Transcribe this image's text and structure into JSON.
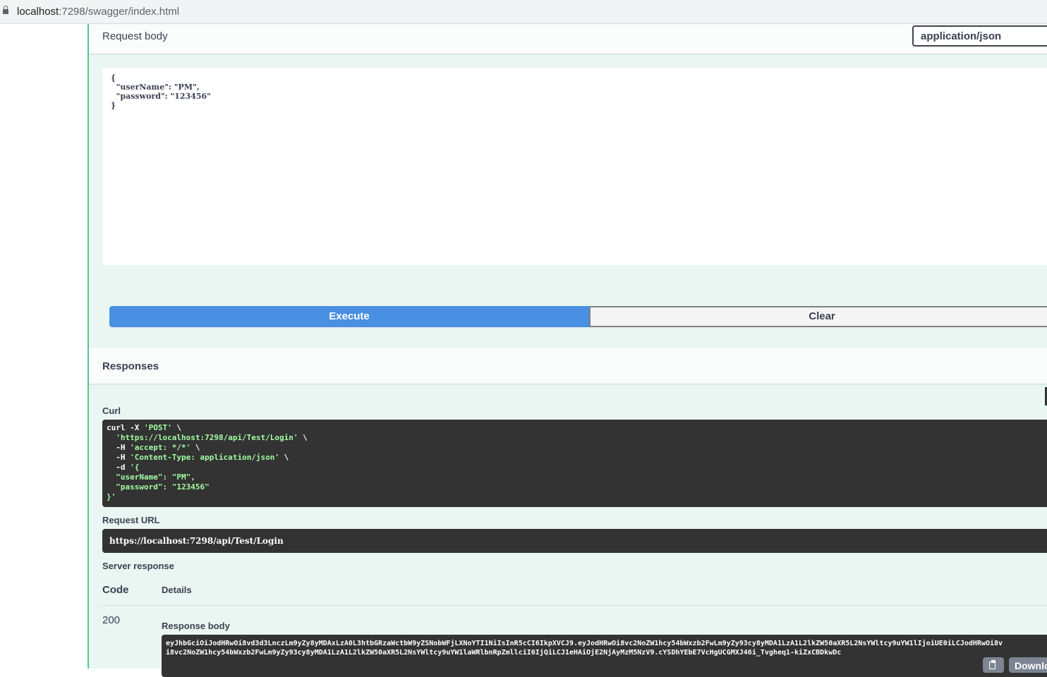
{
  "browser": {
    "url_host": "localhost",
    "url_rest": ":7298/swagger/index.html"
  },
  "request": {
    "title": "Request body",
    "content_type": "application/json",
    "body": "{\n  \"userName\": \"PM\",\n  \"password\": \"123456\"\n}",
    "execute_label": "Execute",
    "clear_label": "Clear"
  },
  "responses": {
    "title": "Responses",
    "curl_label": "Curl",
    "curl_lines": [
      {
        "pre": "curl -X ",
        "str": "'POST'",
        "post": " \\"
      },
      {
        "pre": "  ",
        "str": "'https://localhost:7298/api/Test/Login'",
        "post": " \\"
      },
      {
        "pre": "  -H ",
        "str": "'accept: */*'",
        "post": " \\"
      },
      {
        "pre": "  -H ",
        "str": "'Content-Type: application/json'",
        "post": " \\"
      },
      {
        "pre": "  -d ",
        "str": "'{",
        "post": ""
      },
      {
        "pre": "",
        "str": "  \"userName\": \"PM\",",
        "post": ""
      },
      {
        "pre": "",
        "str": "  \"password\": \"123456\"",
        "post": ""
      },
      {
        "pre": "",
        "str": "}'",
        "post": ""
      }
    ],
    "request_url_label": "Request URL",
    "request_url": "https://localhost:7298/api/Test/Login",
    "server_response_label": "Server response",
    "code_header": "Code",
    "details_header": "Details",
    "code": "200",
    "response_body_label": "Response body",
    "response_body": "eyJhbGciOiJodHRwOi8vd3d3LnczLm9yZy8yMDAxLzA0L3htbGRzaWctbW9yZSNobWFjLXNoYTI1NiIsInR5cCI6IkpXVCJ9.eyJodHRwOi8vc2NoZW1hcy54bWxzb2FwLm9yZy93cy8yMDA1LzA1L2lkZW50aXR5L2NsYWltcy9uYW1lIjoiUE0iLCJodHRwOi8vc2NoZW1hcy54bWxzb2FwLm9yZy93cy8yMDA1LzA1L2lkZW50aXR5L2NsYWltcy9uYW1laWRlbnRpZmllciI6IjQiLCJ1eHAiOjE2NjAyMzM5NzV9.cYSDhYEbE7VcHgUCGMXJ46i_Tvgheq1-kiZxCBDkwDc",
    "response_line1": "eyJhbGciOiJodHRwOi8vd3d3LnczLm9yZy8yMDAxLzA0L3htbGRzaWctbW9yZSNobWFjLXNoYTI1NiIsInR5cCI6IkpXVCJ9.eyJodHRwOi8vc2NoZW1hcy54bWxzb2FwLm9yZy93cy8yMDA1LzA1L2lkZW50aXR5L2NsYWltcy9uYW1lIjoiUE0iLCJodHRwOi8v",
    "response_line2": "i8vc2NoZW1hcy54bWxzb2FwLm9yZy93cy8yMDA1LzA1L2lkZW50aXR5L2NsYWltcy9uYW1laWRlbnRpZmllciI6IjQiLCJ1eHAiOjE2NjAyMzM5NzV9.cYSDhYEbE7VcHgUCGMXJ46i_Tvgheq1-kiZxCBDkwDc",
    "download_label": "Download"
  },
  "icons": {
    "lock": "lock-icon",
    "copy": "copy-icon"
  }
}
